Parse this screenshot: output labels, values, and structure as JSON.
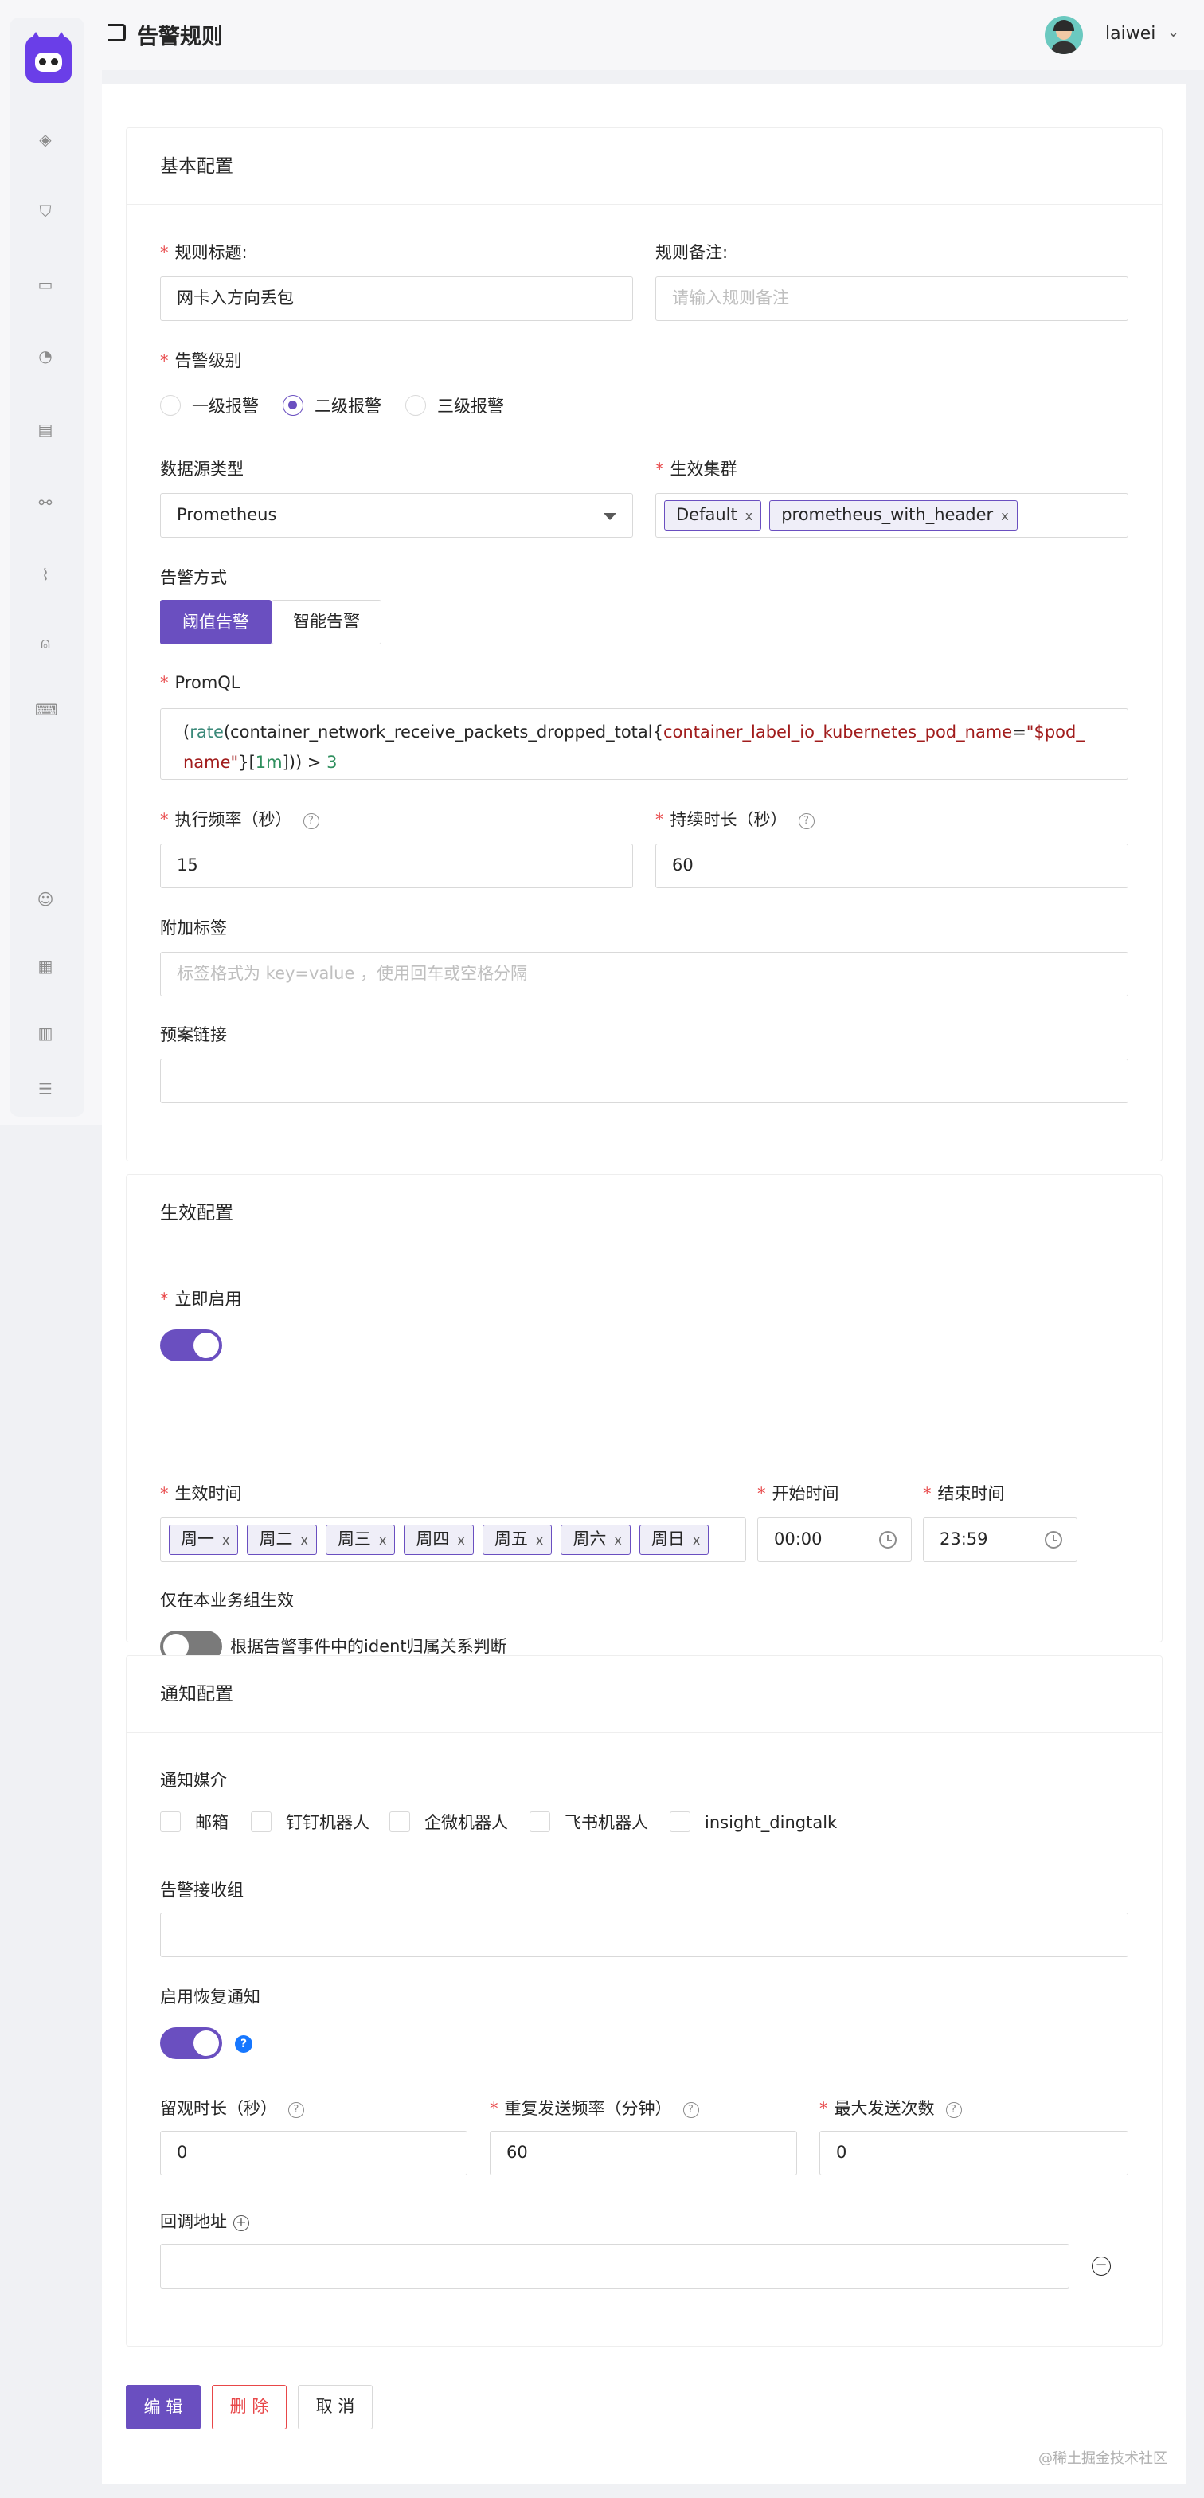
{
  "header": {
    "title": "告警规则",
    "username": "laiwei"
  },
  "sidebar": {
    "icons": [
      "diamond-icon",
      "shield-icon",
      "monitor-icon",
      "dashboard-icon",
      "server-icon",
      "link-icon",
      "chart-icon",
      "alarm-icon",
      "terminal-icon",
      "user-icon",
      "apps-icon",
      "calendar-icon",
      "menu-collapse-icon"
    ]
  },
  "basic": {
    "title": "基本配置",
    "rule_title_label": "规则标题:",
    "rule_title_value": "网卡入方向丢包",
    "rule_note_label": "规则备注:",
    "rule_note_placeholder": "请输入规则备注",
    "severity_label": "告警级别",
    "severity_options": [
      "一级报警",
      "二级报警",
      "三级报警"
    ],
    "severity_selected": "二级报警",
    "datasource_label": "数据源类型",
    "datasource_value": "Prometheus",
    "cluster_label": "生效集群",
    "cluster_tags": [
      "Default",
      "prometheus_with_header"
    ],
    "mode_label": "告警方式",
    "mode_options": [
      "阈值告警",
      "智能告警"
    ],
    "promql_label": "PromQL",
    "promql_line1": {
      "p1": "(",
      "fn": "rate",
      "p2": "(container_network_receive_packets_dropped_total{",
      "lbl": "container_label_io_kubernetes_pod_name",
      "eq": "=",
      "str1": "\"$pod_"
    },
    "promql_line2": {
      "str2": "name\"",
      "p3": "}[",
      "dur": "1m",
      "p4": "])) > ",
      "num": "3"
    },
    "freq_label": "执行频率（秒）",
    "freq_value": "15",
    "duration_label": "持续时长（秒）",
    "duration_value": "60",
    "extra_tags_label": "附加标签",
    "extra_tags_placeholder": "标签格式为 key=value ，使用回车或空格分隔",
    "runbook_label": "预案链接",
    "runbook_value": ""
  },
  "effective": {
    "title": "生效配置",
    "enable_label": "立即启用",
    "enable_on": true,
    "time_label": "生效时间",
    "days": [
      "周一",
      "周二",
      "周三",
      "周四",
      "周五",
      "周六",
      "周日"
    ],
    "start_label": "开始时间",
    "start_value": "00:00",
    "end_label": "结束时间",
    "end_value": "23:59",
    "group_only_label": "仅在本业务组生效",
    "group_only_on": false,
    "group_only_desc": "根据告警事件中的ident归属关系判断"
  },
  "notify": {
    "title": "通知配置",
    "channels_label": "通知媒介",
    "channels": [
      "邮箱",
      "钉钉机器人",
      "企微机器人",
      "飞书机器人",
      "insight_dingtalk"
    ],
    "receivers_label": "告警接收组",
    "recovery_label": "启用恢复通知",
    "recovery_on": true,
    "observe_label": "留观时长（秒）",
    "observe_value": "0",
    "repeat_label": "重复发送频率（分钟）",
    "repeat_value": "60",
    "max_label": "最大发送次数",
    "max_value": "0",
    "callback_label": "回调地址",
    "callback_value": ""
  },
  "actions": {
    "edit": "编 辑",
    "delete": "删 除",
    "cancel": "取 消"
  },
  "watermark": "@稀土掘金技术社区",
  "colors": {
    "primary": "#6a4fc0",
    "danger": "#e84749",
    "required": "#e84749"
  }
}
